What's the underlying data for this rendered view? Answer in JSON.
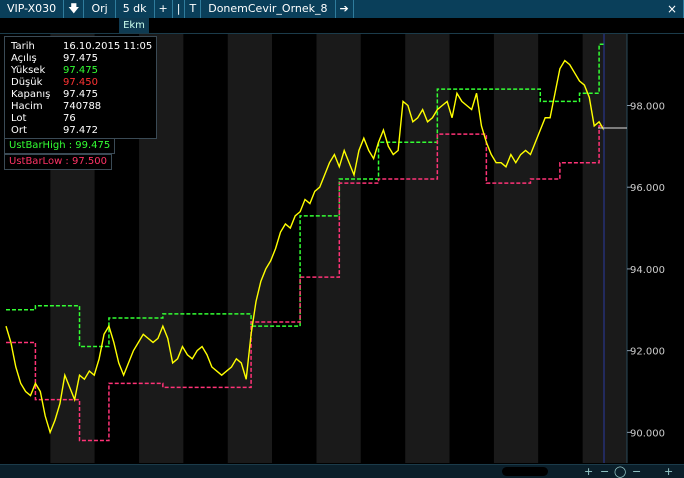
{
  "toolbar": {
    "symbol": "VIP-X030",
    "mode": "Orj",
    "period": "5 dk",
    "plus": "+",
    "sep": "|",
    "t": "T",
    "template": "DonemCevir_Ornek_8",
    "arrow_down": "🡇",
    "arrow_right": "➔",
    "close": "×"
  },
  "tab": {
    "label": "Ekm"
  },
  "info": [
    {
      "k": "Tarih",
      "v": "16.10.2015 11:05",
      "color": "#ffffff"
    },
    {
      "k": "Açılış",
      "v": "97.475",
      "color": "#ffffff"
    },
    {
      "k": "Yüksek",
      "v": "97.475",
      "color": "#33ff33"
    },
    {
      "k": "Düşük",
      "v": "97.450",
      "color": "#ff3333"
    },
    {
      "k": "Kapanış",
      "v": "97.475",
      "color": "#ffffff"
    },
    {
      "k": "Hacim",
      "v": "740788",
      "color": "#ffffff"
    },
    {
      "k": "Lot",
      "v": "76",
      "color": "#ffffff"
    },
    {
      "k": "Ort",
      "v": "97.472",
      "color": "#ffffff"
    }
  ],
  "legend": {
    "high": {
      "label": "UstBarHigh : 99.475",
      "color": "#33ff33"
    },
    "low": {
      "label": "UstBarLow : 97.500",
      "color": "#ff3366"
    }
  },
  "scroll": {
    "plus": "+",
    "minus": "−",
    "circle": "◯"
  },
  "chart_data": {
    "type": "line",
    "ylim": [
      89.25,
      99.75
    ],
    "y_ticks": [
      "98.000",
      "96.000",
      "94.000",
      "92.000",
      "90.000"
    ],
    "y_tick_values": [
      98,
      96,
      94,
      92,
      90
    ],
    "last_price": 97.45,
    "colors": {
      "price": "#ffff00",
      "high": "#33ff33",
      "low": "#ff3377",
      "bandA": "#000000",
      "bandB": "#1a1a1a"
    },
    "series": [
      {
        "values": [
          92.6,
          92.2,
          91.6,
          91.2,
          91.0,
          90.9,
          91.2,
          91.0,
          90.4,
          90.0,
          90.3,
          90.7,
          91.4,
          91.1,
          90.8,
          91.4,
          91.3,
          91.5,
          91.4,
          91.8,
          92.4,
          92.6,
          92.2,
          91.7,
          91.4,
          91.7,
          92.0,
          92.2,
          92.4,
          92.3,
          92.2,
          92.3,
          92.6,
          92.3,
          91.7,
          91.8,
          92.1,
          91.9,
          91.8,
          92.0,
          92.1,
          91.9,
          91.6,
          91.5,
          91.4,
          91.5,
          91.6,
          91.8,
          91.7,
          91.3,
          92.4,
          93.2,
          93.7,
          94.0,
          94.2,
          94.5,
          94.9,
          95.1,
          95.0,
          95.3,
          95.4,
          95.7,
          95.6,
          95.9,
          96.0,
          96.3,
          96.6,
          96.8,
          96.5,
          96.9,
          96.6,
          96.3,
          96.9,
          97.2,
          96.9,
          96.7,
          97.1,
          97.4,
          97.0,
          96.8,
          96.9,
          98.1,
          98.0,
          97.6,
          97.7,
          97.9,
          97.6,
          97.7,
          97.9,
          98.0,
          98.1,
          97.7,
          98.3,
          98.1,
          98.0,
          97.9,
          98.3,
          97.5,
          97.1,
          96.8,
          96.6,
          96.6,
          96.5,
          96.8,
          96.6,
          96.8,
          96.9,
          96.8,
          97.1,
          97.4,
          97.7,
          97.7,
          98.3,
          98.9,
          99.1,
          99.0,
          98.8,
          98.6,
          98.5,
          98.2,
          97.5,
          97.6,
          97.4
        ]
      },
      {
        "values": [
          93.0,
          93.0,
          93.0,
          93.0,
          93.0,
          93.0,
          93.1,
          93.1,
          93.1,
          93.1,
          93.1,
          93.1,
          93.1,
          93.1,
          93.1,
          92.1,
          92.1,
          92.1,
          92.1,
          92.1,
          92.1,
          92.8,
          92.8,
          92.8,
          92.8,
          92.8,
          92.8,
          92.8,
          92.8,
          92.8,
          92.8,
          92.8,
          92.9,
          92.9,
          92.9,
          92.9,
          92.9,
          92.9,
          92.9,
          92.9,
          92.9,
          92.9,
          92.9,
          92.9,
          92.9,
          92.9,
          92.9,
          92.9,
          92.9,
          92.9,
          92.6,
          92.6,
          92.6,
          92.6,
          92.6,
          92.6,
          92.6,
          92.6,
          92.6,
          92.6,
          95.3,
          95.3,
          95.3,
          95.3,
          95.3,
          95.3,
          95.3,
          95.3,
          96.2,
          96.2,
          96.2,
          96.2,
          96.2,
          96.2,
          96.2,
          96.2,
          97.1,
          97.1,
          97.1,
          97.1,
          97.1,
          97.1,
          97.1,
          97.1,
          97.1,
          97.1,
          97.1,
          97.1,
          98.4,
          98.4,
          98.4,
          98.4,
          98.4,
          98.4,
          98.4,
          98.4,
          98.4,
          98.4,
          98.4,
          98.4,
          98.4,
          98.4,
          98.4,
          98.4,
          98.4,
          98.4,
          98.4,
          98.4,
          98.4,
          98.1,
          98.1,
          98.1,
          98.1,
          98.1,
          98.1,
          98.1,
          98.1,
          98.3,
          98.3,
          98.3,
          98.3,
          99.5,
          99.5
        ]
      },
      {
        "values": [
          92.2,
          92.2,
          92.2,
          92.2,
          92.2,
          92.2,
          90.8,
          90.8,
          90.8,
          90.8,
          90.8,
          90.8,
          90.8,
          90.8,
          90.8,
          89.8,
          89.8,
          89.8,
          89.8,
          89.8,
          89.8,
          91.2,
          91.2,
          91.2,
          91.2,
          91.2,
          91.2,
          91.2,
          91.2,
          91.2,
          91.2,
          91.2,
          91.1,
          91.1,
          91.1,
          91.1,
          91.1,
          91.1,
          91.1,
          91.1,
          91.1,
          91.1,
          91.1,
          91.1,
          91.1,
          91.1,
          91.1,
          91.1,
          91.1,
          91.1,
          92.7,
          92.7,
          92.7,
          92.7,
          92.7,
          92.7,
          92.7,
          92.7,
          92.7,
          92.7,
          93.8,
          93.8,
          93.8,
          93.8,
          93.8,
          93.8,
          93.8,
          93.8,
          96.1,
          96.1,
          96.1,
          96.1,
          96.1,
          96.1,
          96.1,
          96.1,
          96.2,
          96.2,
          96.2,
          96.2,
          96.2,
          96.2,
          96.2,
          96.2,
          96.2,
          96.2,
          96.2,
          96.2,
          97.3,
          97.3,
          97.3,
          97.3,
          97.3,
          97.3,
          97.3,
          97.3,
          97.3,
          97.3,
          96.1,
          96.1,
          96.1,
          96.1,
          96.1,
          96.1,
          96.1,
          96.1,
          96.1,
          96.2,
          96.2,
          96.2,
          96.2,
          96.2,
          96.2,
          96.6,
          96.6,
          96.6,
          96.6,
          96.6,
          96.6,
          96.6,
          96.6,
          97.5,
          97.5
        ]
      }
    ]
  }
}
